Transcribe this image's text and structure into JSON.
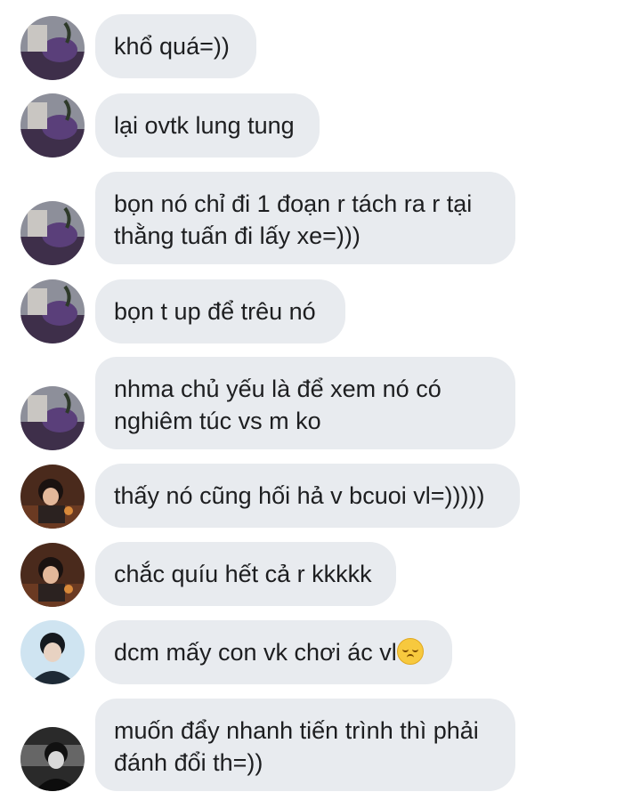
{
  "messages": [
    {
      "avatar": "avatar-user-a",
      "lines": [
        "khổ quá=))"
      ]
    },
    {
      "avatar": "avatar-user-a",
      "lines": [
        "lại ovtk lung tung"
      ]
    },
    {
      "avatar": "avatar-user-a",
      "lines": [
        "bọn nó chỉ đi 1 đoạn r tách ra r tại",
        "thằng tuấn đi lấy xe=)))"
      ]
    },
    {
      "avatar": "avatar-user-a",
      "lines": [
        "bọn t up để trêu nó"
      ]
    },
    {
      "avatar": "avatar-user-a",
      "lines": [
        "nhma chủ yếu là để xem nó có",
        "nghiêm túc vs m ko"
      ]
    },
    {
      "avatar": "avatar-user-b",
      "lines": [
        "thấy nó cũng hối hả v bcuoi vl=)))))"
      ]
    },
    {
      "avatar": "avatar-user-b",
      "lines": [
        "chắc quíu hết cả r kkkkk"
      ]
    },
    {
      "avatar": "avatar-user-c",
      "lines": [
        "dcm mấy con vk chơi ác vl"
      ],
      "emoji": "pensive-face-icon"
    },
    {
      "avatar": "avatar-user-d",
      "lines": [
        "muốn đẩy nhanh tiến trình thì phải",
        "đánh đổi th=))"
      ]
    }
  ],
  "colors": {
    "bubble": "#e8ebef",
    "text": "#1d1e20",
    "background": "#ffffff"
  }
}
